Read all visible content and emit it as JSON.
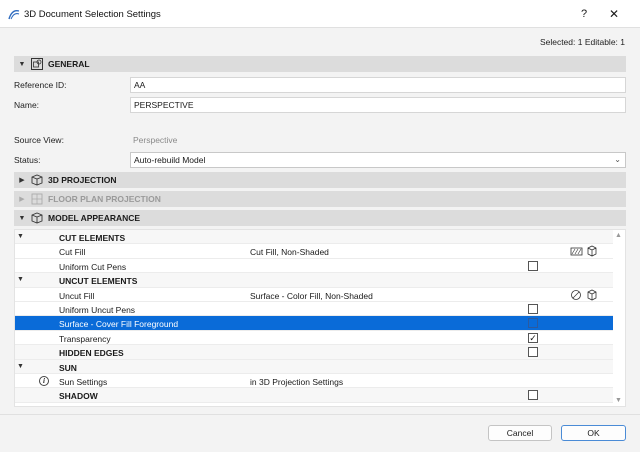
{
  "window": {
    "title": "3D Document Selection Settings",
    "help_label": "?",
    "close_label": "✕"
  },
  "selection_info": "Selected: 1 Editable: 1",
  "sections": {
    "general": "GENERAL",
    "projection_3d": "3D PROJECTION",
    "floor_plan": "FLOOR PLAN PROJECTION",
    "model_appearance": "MODEL APPEARANCE"
  },
  "general": {
    "reference_id_label": "Reference ID:",
    "reference_id_value": "AA",
    "name_label": "Name:",
    "name_value": "PERSPECTIVE",
    "source_view_label": "Source View:",
    "source_view_value": "Perspective",
    "status_label": "Status:",
    "status_value": "Auto-rebuild Model"
  },
  "grid_rows": [
    {
      "name": "CUT ELEMENTS",
      "value": "",
      "type": "group",
      "expanded": true
    },
    {
      "name": "Cut Fill",
      "value": "Cut Fill, Non-Shaded",
      "type": "item"
    },
    {
      "name": "Uniform Cut Pens",
      "value": "",
      "type": "check",
      "checked": false
    },
    {
      "name": "UNCUT ELEMENTS",
      "value": "",
      "type": "group",
      "expanded": true
    },
    {
      "name": "Uncut Fill",
      "value": "Surface - Color Fill, Non-Shaded",
      "type": "item"
    },
    {
      "name": "Uniform Uncut Pens",
      "value": "",
      "type": "check",
      "checked": false
    },
    {
      "name": "Surface - Cover Fill Foreground",
      "value": "",
      "type": "check",
      "checked": false,
      "selected": true
    },
    {
      "name": "Transparency",
      "value": "",
      "type": "check",
      "checked": true
    },
    {
      "name": "HIDDEN EDGES",
      "value": "",
      "type": "group-check",
      "checked": false
    },
    {
      "name": "SUN",
      "value": "",
      "type": "group",
      "expanded": true
    },
    {
      "name": "Sun Settings",
      "value": "in 3D Projection Settings",
      "type": "info"
    },
    {
      "name": "SHADOW",
      "value": "",
      "type": "group-check",
      "checked": false
    }
  ],
  "buttons": {
    "cancel": "Cancel",
    "ok": "OK"
  },
  "colors": {
    "selection": "#0a6bd8",
    "section_header": "#dcdcdc"
  }
}
